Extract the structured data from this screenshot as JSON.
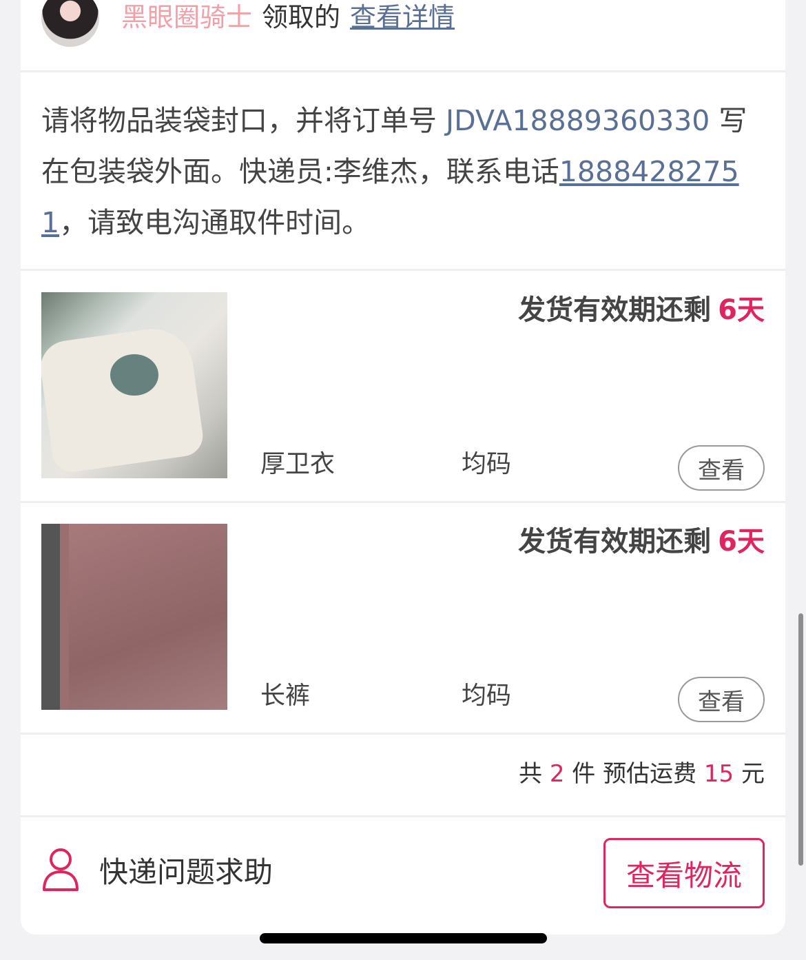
{
  "header": {
    "nickname": "黑眼圈骑士",
    "claimed_text": "领取的",
    "detail_link": "查看详情"
  },
  "instruction": {
    "part1": "请将物品装袋封口，并将订单号 ",
    "order_no": "JDVA18889360330",
    "part2": " 写在包装袋外面。快递员:李维杰，联系电话",
    "phone": "18884282751",
    "part3": "，请致电沟通取件时间。"
  },
  "items": [
    {
      "remain_label": "发货有效期还剩",
      "remain_days": "6天",
      "name": "厚卫衣",
      "size": "均码",
      "view_label": "查看"
    },
    {
      "remain_label": "发货有效期还剩",
      "remain_days": "6天",
      "name": "长裤",
      "size": "均码",
      "view_label": "查看"
    }
  ],
  "summary": {
    "prefix": "共",
    "count": "2",
    "mid": "件 预估运费",
    "fee": "15",
    "unit": "元"
  },
  "footer": {
    "help_label": "快递问题求助",
    "logistics_button": "查看物流"
  },
  "colors": {
    "accent": "#e0245e",
    "link": "#5a6f96",
    "nickname": "#f2a0a8"
  }
}
